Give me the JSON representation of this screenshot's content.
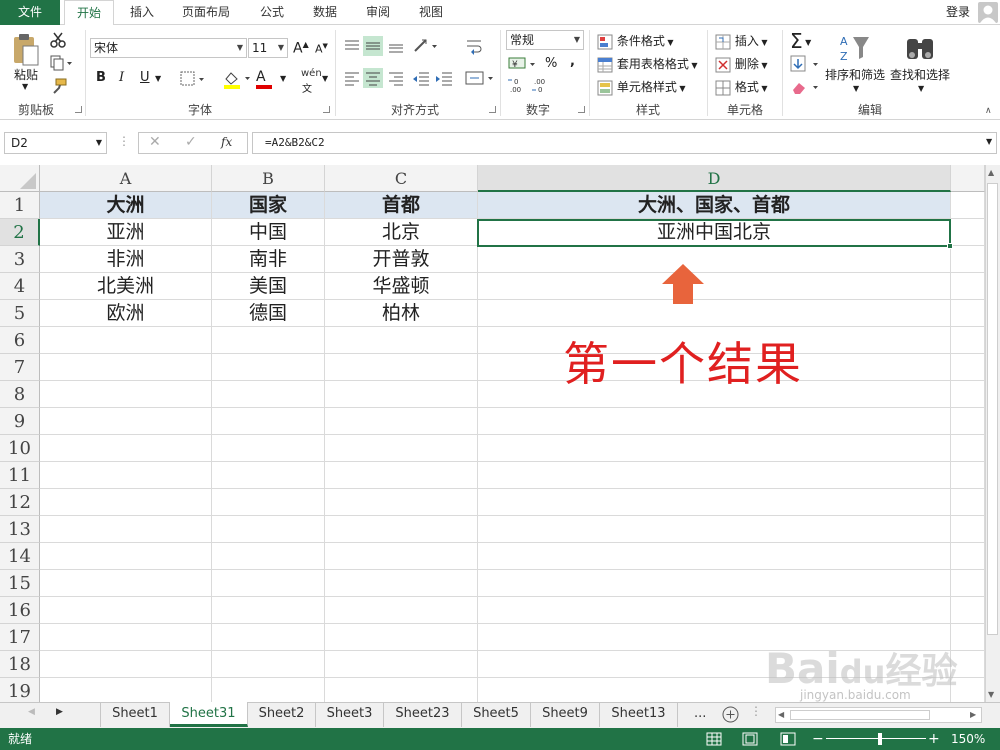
{
  "tabs": {
    "file": "文件",
    "items": [
      "开始",
      "插入",
      "页面布局",
      "公式",
      "数据",
      "审阅",
      "视图"
    ],
    "login": "登录"
  },
  "ribbon": {
    "clipboard": {
      "label": "剪贴板",
      "paste": "粘贴"
    },
    "font": {
      "label": "字体",
      "name": "宋体",
      "size": "11",
      "bold": "B",
      "italic": "I",
      "underline": "U",
      "grow": "A",
      "shrink": "A",
      "color_a": "A",
      "pinyin": "wén"
    },
    "alignment": {
      "label": "对齐方式"
    },
    "number": {
      "label": "数字",
      "format": "常规",
      "percent": "%",
      "comma": ","
    },
    "styles": {
      "label": "样式",
      "conditional": "条件格式",
      "table": "套用表格格式",
      "cell_styles": "单元格样式"
    },
    "cells": {
      "label": "单元格",
      "insert": "插入",
      "delete": "删除",
      "format": "格式"
    },
    "editing": {
      "label": "编辑",
      "sort": "排序和筛选",
      "find": "查找和选择",
      "sigma": "Σ"
    }
  },
  "formula_bar": {
    "name_box": "D2",
    "fx": "fx",
    "formula": "=A2&B2&C2"
  },
  "columns": [
    "A",
    "B",
    "C",
    "D"
  ],
  "rows": [
    "1",
    "2",
    "3",
    "4",
    "5",
    "6",
    "7",
    "8",
    "9",
    "10",
    "11",
    "12",
    "13",
    "14",
    "15",
    "16",
    "17",
    "18",
    "19"
  ],
  "cells": {
    "r1": [
      "大洲",
      "国家",
      "首都",
      "大洲、国家、首都"
    ],
    "r2": [
      "亚洲",
      "中国",
      "北京",
      "亚洲中国北京"
    ],
    "r3": [
      "非洲",
      "南非",
      "开普敦",
      ""
    ],
    "r4": [
      "北美洲",
      "美国",
      "华盛顿",
      ""
    ],
    "r5": [
      "欧洲",
      "德国",
      "柏林",
      ""
    ]
  },
  "annotation": "第一个结果",
  "sheets": [
    "Sheet1",
    "Sheet31",
    "Sheet2",
    "Sheet3",
    "Sheet23",
    "Sheet5",
    "Sheet9",
    "Sheet13"
  ],
  "sheets_more": "...",
  "status": {
    "ready": "就绪",
    "zoom": "150%"
  },
  "colors": {
    "accent": "#217346",
    "annotation": "#e02020",
    "arrow": "#e8643c",
    "header_fill": "#dce6f1"
  }
}
